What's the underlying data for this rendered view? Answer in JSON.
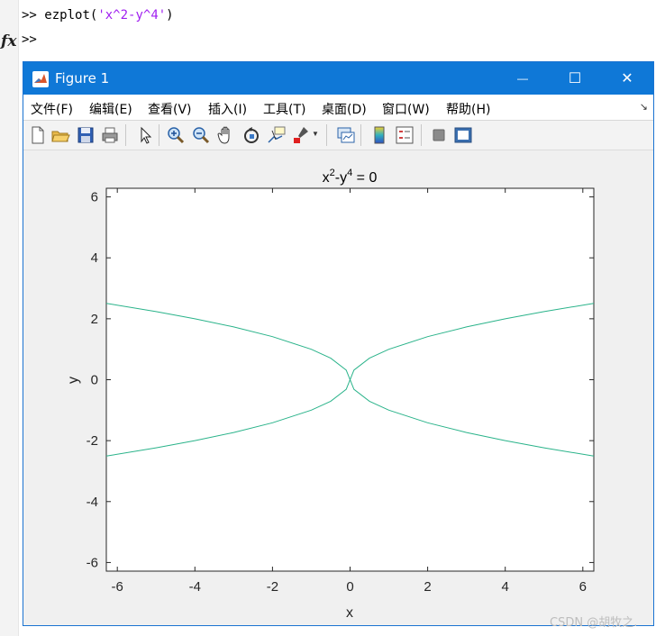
{
  "command_window": {
    "prompt1": ">> ",
    "cmd_func": "ezplot(",
    "cmd_arg": "'x^2-y^4'",
    "cmd_close": ")",
    "prompt2": ">>",
    "fx_label": "fx"
  },
  "figure_window": {
    "title": "Figure 1",
    "minimize_glyph": "—",
    "maximize_glyph": "☐",
    "close_glyph": "✕",
    "menus": [
      "文件(F)",
      "编辑(E)",
      "查看(V)",
      "插入(I)",
      "工具(T)",
      "桌面(D)",
      "窗口(W)",
      "帮助(H)"
    ],
    "menu_overflow_glyph": "↘",
    "toolbar_icons": [
      "new-figure-icon",
      "open-file-icon",
      "save-icon",
      "print-icon",
      "select-arrow-icon",
      "zoom-in-icon",
      "zoom-out-icon",
      "pan-hand-icon",
      "rotate-3d-icon",
      "data-cursor-icon",
      "brush-icon",
      "link-plot-icon",
      "colorbar-icon",
      "legend-icon",
      "hide-plot-tools-icon",
      "show-plot-tools-icon"
    ],
    "accent_color": "#0f78d7"
  },
  "chart_data": {
    "type": "line",
    "title_base": "x",
    "title_sup1": "2",
    "title_mid": "-y",
    "title_sup2": "4",
    "title_tail": " = 0",
    "xlabel": "x",
    "ylabel": "y",
    "xlim": [
      -6.2832,
      6.2832
    ],
    "ylim": [
      -6.2832,
      6.2832
    ],
    "xticks": [
      -6,
      -4,
      -2,
      0,
      2,
      4,
      6
    ],
    "yticks": [
      -6,
      -4,
      -2,
      0,
      2,
      4,
      6
    ],
    "xtick_labels": [
      "-6",
      "-4",
      "-2",
      "0",
      "2",
      "4",
      "6"
    ],
    "ytick_labels": [
      "-6",
      "-4",
      "-2",
      "0",
      "2",
      "4",
      "6"
    ],
    "series": [
      {
        "x": [
          -6.2832,
          -5,
          -4,
          -3,
          -2,
          -1,
          -0.5,
          -0.1,
          0,
          0.1,
          0.5,
          1,
          2,
          3,
          4,
          5,
          6.2832
        ],
        "y": [
          2.5066,
          2.2361,
          2.0,
          1.7321,
          1.4142,
          1.0,
          0.7071,
          0.3162,
          0,
          0.3162,
          0.7071,
          1.0,
          1.4142,
          1.7321,
          2.0,
          2.2361,
          2.5066
        ]
      },
      {
        "x": [
          -6.2832,
          -5,
          -4,
          -3,
          -2,
          -1,
          -0.5,
          -0.1,
          0,
          0.1,
          0.5,
          1,
          2,
          3,
          4,
          5,
          6.2832
        ],
        "y": [
          -2.5066,
          -2.2361,
          -2.0,
          -1.7321,
          -1.4142,
          -1.0,
          -0.7071,
          -0.3162,
          0,
          -0.3162,
          -0.7071,
          -1.0,
          -1.4142,
          -1.7321,
          -2.0,
          -2.2361,
          -2.5066
        ]
      }
    ],
    "line_color": "#2ab38a",
    "grid": false
  },
  "watermark": "CSDN @胡牧之."
}
